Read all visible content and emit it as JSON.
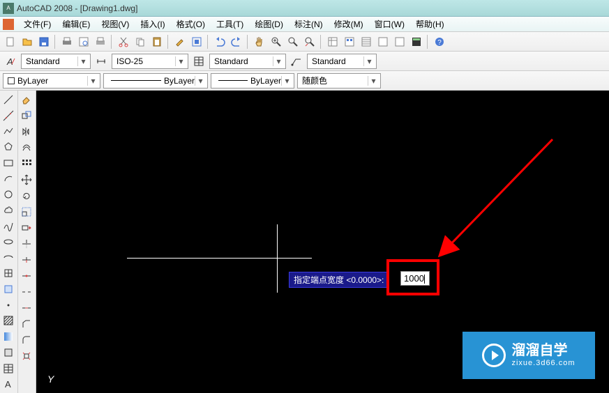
{
  "title": "AutoCAD 2008 - [Drawing1.dwg]",
  "menu": {
    "file": "文件(F)",
    "edit": "编辑(E)",
    "view": "视图(V)",
    "insert": "插入(I)",
    "format": "格式(O)",
    "tools": "工具(T)",
    "draw": "绘图(D)",
    "dimension": "标注(N)",
    "modify": "修改(M)",
    "window": "窗口(W)",
    "help": "帮助(H)"
  },
  "styles": {
    "text_style": "Standard",
    "dim_style": "ISO-25",
    "table_style": "Standard",
    "mleader_style": "Standard"
  },
  "layers": {
    "current": "ByLayer",
    "linetype": "ByLayer",
    "lineweight": "ByLayer",
    "color_label": "随颜色"
  },
  "command": {
    "prompt": "指定端点宽度 <0.0000>:",
    "input_value": "1000"
  },
  "ucs": {
    "y_label": "Y"
  },
  "watermark": {
    "brand": "溜溜自学",
    "url": "zixue.3d66.com"
  }
}
